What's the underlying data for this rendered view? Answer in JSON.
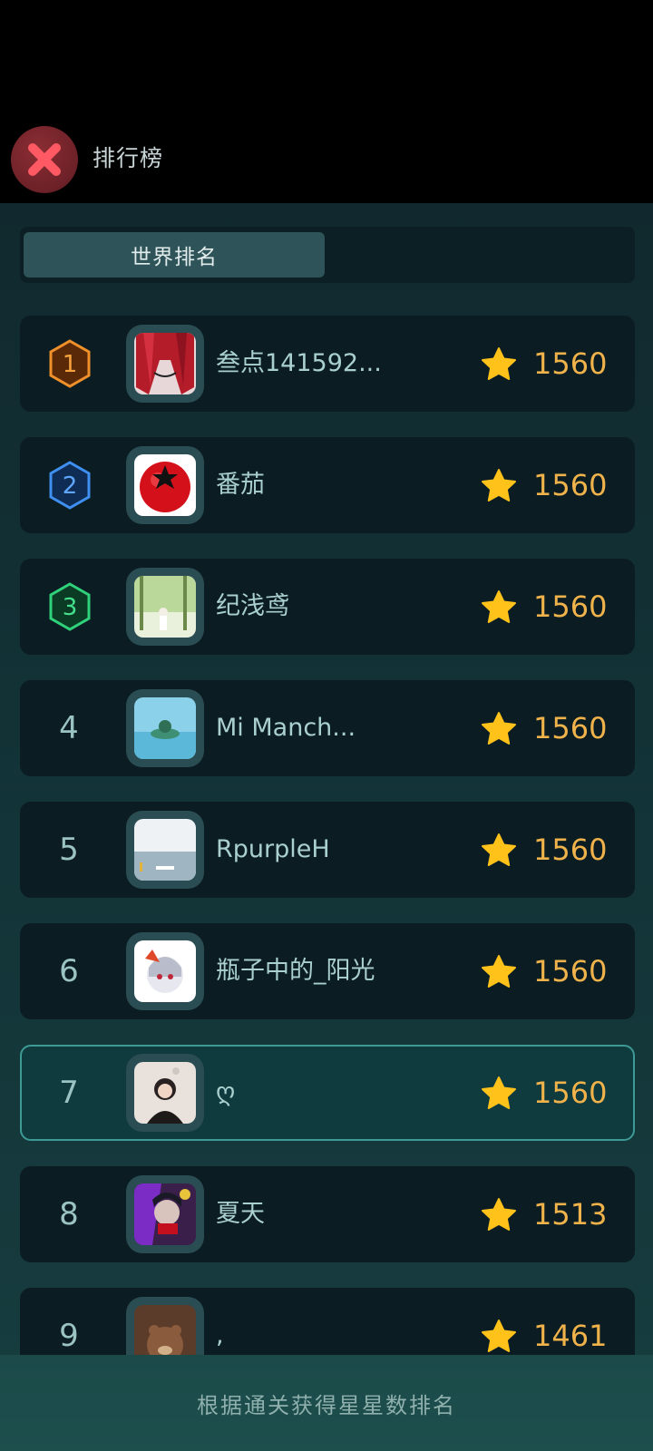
{
  "header": {
    "title": "排行榜",
    "close_icon": "close-icon"
  },
  "tabs": [
    {
      "label": "世界排名",
      "active": true
    }
  ],
  "leaderboard": [
    {
      "rank": "1",
      "medal_color": "#f0902a",
      "name": "叁点141592...",
      "score": "1560"
    },
    {
      "rank": "2",
      "medal_color": "#3f8ff0",
      "name": "番茄",
      "score": "1560"
    },
    {
      "rank": "3",
      "medal_color": "#2fd17a",
      "name": "纪浅鸢",
      "score": "1560"
    },
    {
      "rank": "4",
      "name": "Mi Manch...",
      "score": "1560"
    },
    {
      "rank": "5",
      "name": "RpurpleH",
      "score": "1560"
    },
    {
      "rank": "6",
      "name": "瓶子中的_阳光",
      "score": "1560"
    },
    {
      "rank": "7",
      "name": "ღ",
      "score": "1560",
      "is_current_user": true
    },
    {
      "rank": "8",
      "name": "夏天",
      "score": "1513"
    },
    {
      "rank": "9",
      "name": ",",
      "score": "1461"
    }
  ],
  "footer": {
    "note": "根据通关获得星星数排名"
  },
  "colors": {
    "accent": "#3d9a95",
    "score": "#f0b24a",
    "star": "#ffc21a",
    "close": "#ff5a63"
  }
}
